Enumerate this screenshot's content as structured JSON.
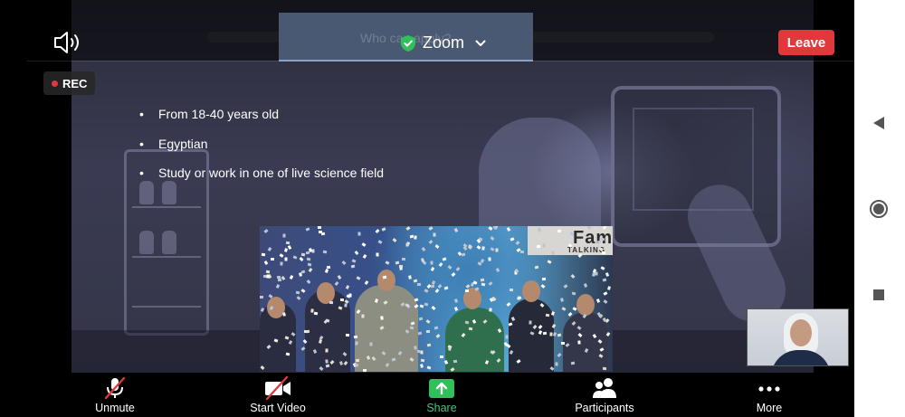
{
  "header": {
    "ghost_title": "Who can apply?",
    "app_label": "Zoom",
    "leave_label": "Leave",
    "recording_label": "REC"
  },
  "slide": {
    "bullets": [
      "From 18-40 years old",
      "Egyptian",
      "Study or work in one of live science field"
    ]
  },
  "video": {
    "banner_text": "Fame",
    "banner_subtext": "TALKING"
  },
  "toolbar": {
    "unmute_label": "Unmute",
    "start_video_label": "Start Video",
    "share_label": "Share",
    "participants_label": "Participants",
    "more_label": "More"
  },
  "colors": {
    "leave": "#e0393b",
    "share_accent": "#4cc17a",
    "mute_slash": "#e0393b"
  },
  "icons": [
    "speaker-icon",
    "shield-check-icon",
    "chevron-down-icon",
    "mic-muted-icon",
    "video-off-icon",
    "share-arrow-icon",
    "participants-icon",
    "more-dots-icon",
    "back-icon",
    "home-icon",
    "recents-icon"
  ]
}
